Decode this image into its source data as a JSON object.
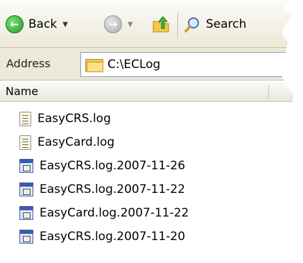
{
  "toolbar": {
    "back_label": "Back",
    "search_label": "Search"
  },
  "address": {
    "label": "Address",
    "path": "C:\\ECLog"
  },
  "list": {
    "column_name": "Name",
    "files": [
      {
        "name": "EasyCRS.log",
        "icon": "text-file-icon"
      },
      {
        "name": "EasyCard.log",
        "icon": "text-file-icon"
      },
      {
        "name": "EasyCRS.log.2007-11-26",
        "icon": "generic-file-icon"
      },
      {
        "name": "EasyCRS.log.2007-11-22",
        "icon": "generic-file-icon"
      },
      {
        "name": "EasyCard.log.2007-11-22",
        "icon": "generic-file-icon"
      },
      {
        "name": "EasyCRS.log.2007-11-20",
        "icon": "generic-file-icon"
      }
    ]
  }
}
